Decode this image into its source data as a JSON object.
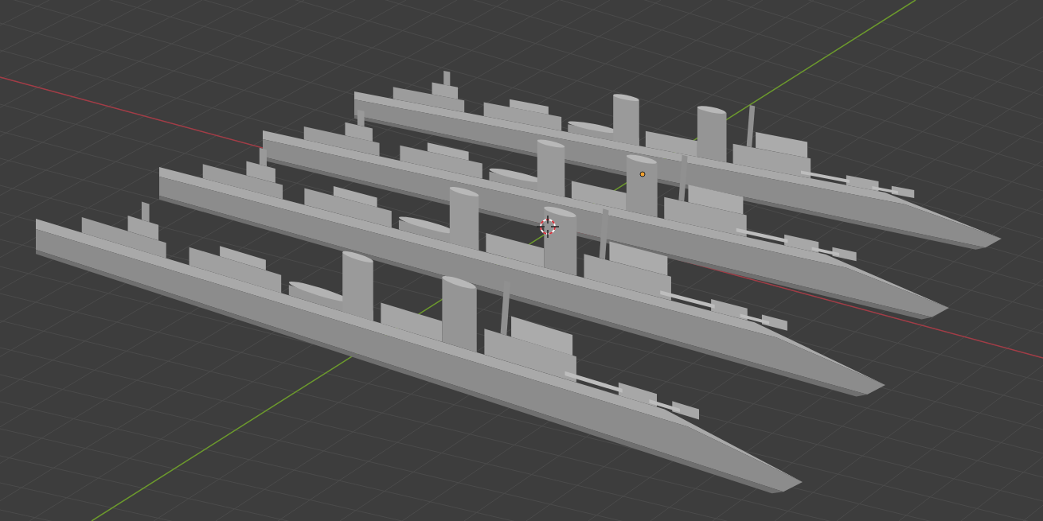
{
  "viewport": {
    "objects": [
      {
        "kind": "ship"
      },
      {
        "kind": "ship"
      },
      {
        "kind": "ship"
      },
      {
        "kind": "ship"
      }
    ],
    "markers": [
      {
        "kind": "cursor"
      },
      {
        "kind": "origin"
      }
    ]
  }
}
